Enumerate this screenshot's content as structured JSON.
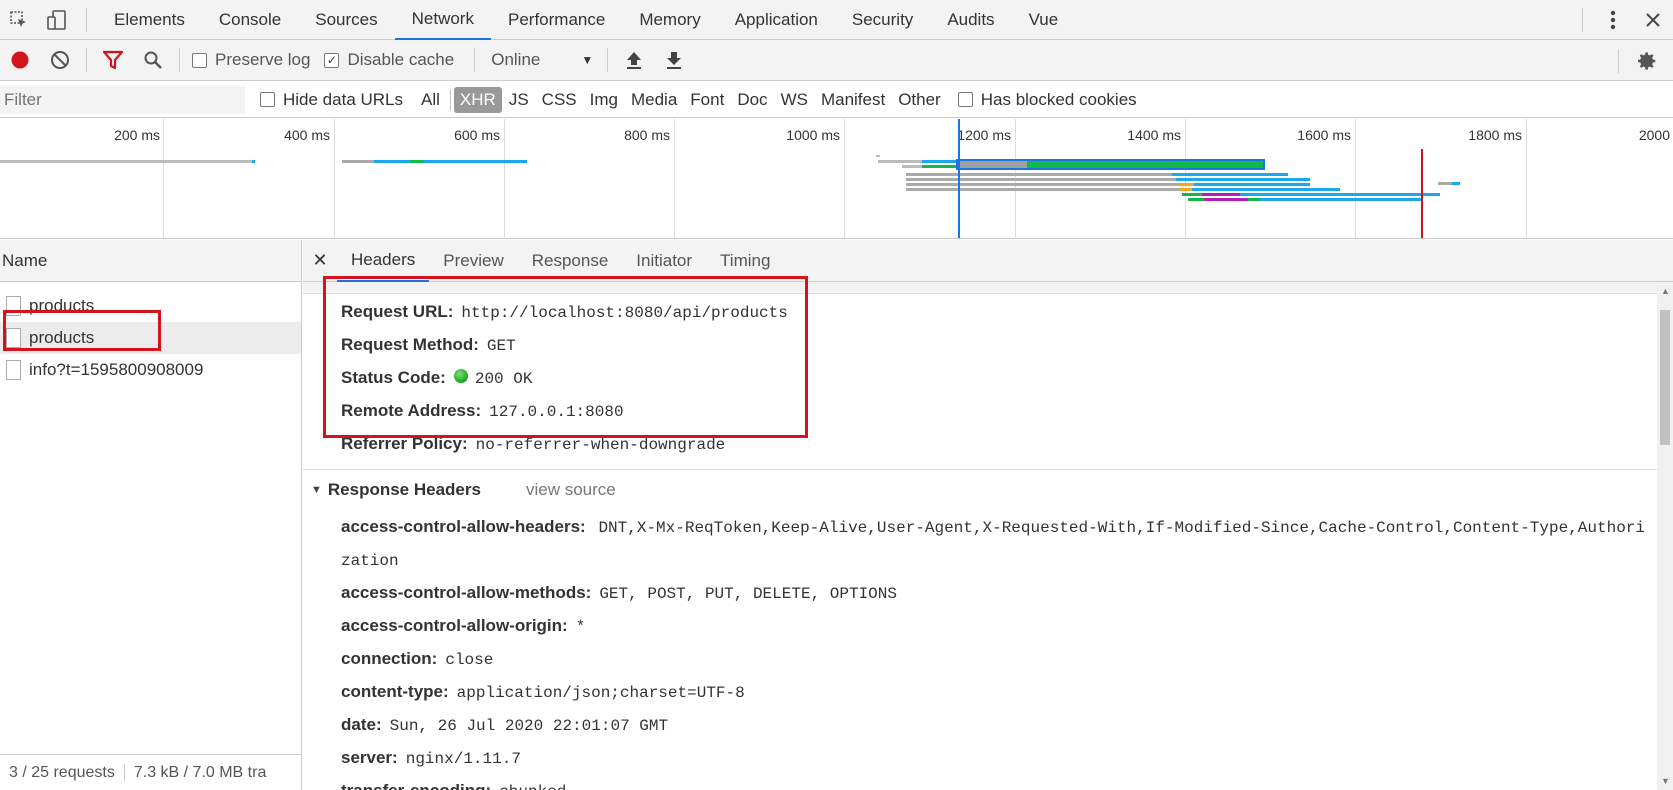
{
  "topbar": {
    "tabs": [
      "Elements",
      "Console",
      "Sources",
      "Network",
      "Performance",
      "Memory",
      "Application",
      "Security",
      "Audits",
      "Vue"
    ],
    "active_tab": "Network"
  },
  "toolbar": {
    "preserve_log_label": "Preserve log",
    "preserve_log_checked": false,
    "disable_cache_label": "Disable cache",
    "disable_cache_checked": true,
    "throttle_value": "Online"
  },
  "filterbar": {
    "filter_placeholder": "Filter",
    "hide_data_urls_label": "Hide data URLs",
    "types": [
      "All",
      "XHR",
      "JS",
      "CSS",
      "Img",
      "Media",
      "Font",
      "Doc",
      "WS",
      "Manifest",
      "Other"
    ],
    "active_type": "XHR",
    "has_blocked_cookies_label": "Has blocked cookies"
  },
  "overview": {
    "ticks": [
      "200 ms",
      "400 ms",
      "600 ms",
      "800 ms",
      "1000 ms",
      "1200 ms",
      "1400 ms",
      "1600 ms",
      "1800 ms",
      "2000"
    ]
  },
  "requests": {
    "column_name": "Name",
    "items": [
      "products",
      "products",
      "info?t=1595800908009"
    ],
    "selected_index": 1,
    "footer_requests": "3 / 25 requests",
    "footer_transferred": "7.3 kB / 7.0 MB tra"
  },
  "detail": {
    "tabs": [
      "Headers",
      "Preview",
      "Response",
      "Initiator",
      "Timing"
    ],
    "active_tab": "Headers",
    "general": [
      {
        "key": "Request URL:",
        "value": "http://localhost:8080/api/products"
      },
      {
        "key": "Request Method:",
        "value": "GET"
      },
      {
        "key": "Status Code:",
        "value": "200 OK",
        "status_color": "#18a418"
      },
      {
        "key": "Remote Address:",
        "value": "127.0.0.1:8080"
      },
      {
        "key": "Referrer Policy:",
        "value": "no-referrer-when-downgrade"
      }
    ],
    "response_headers_title": "Response Headers",
    "view_source_label": "view source",
    "response_headers": [
      {
        "key": "access-control-allow-headers:",
        "value": "DNT,X-Mx-ReqToken,Keep-Alive,User-Agent,X-Requested-With,If-Modified-Since,Cache-Control,Content-Type,Authorization"
      },
      {
        "key": "access-control-allow-methods:",
        "value": "GET, POST, PUT, DELETE, OPTIONS"
      },
      {
        "key": "access-control-allow-origin:",
        "value": "*"
      },
      {
        "key": "connection:",
        "value": "close"
      },
      {
        "key": "content-type:",
        "value": "application/json;charset=UTF-8"
      },
      {
        "key": "date:",
        "value": "Sun, 26 Jul 2020 22:01:07 GMT"
      },
      {
        "key": "server:",
        "value": "nginx/1.11.7"
      },
      {
        "key": "transfer-encoding:",
        "value": "chunked"
      }
    ]
  },
  "colors": {
    "accent": "#1a73e8",
    "record_red": "#d2141c",
    "highlight_box": "#d2141c",
    "timeline_blue": "#1aa7ec",
    "timeline_green": "#12b84a",
    "timeline_gray": "#a0a0a0"
  }
}
